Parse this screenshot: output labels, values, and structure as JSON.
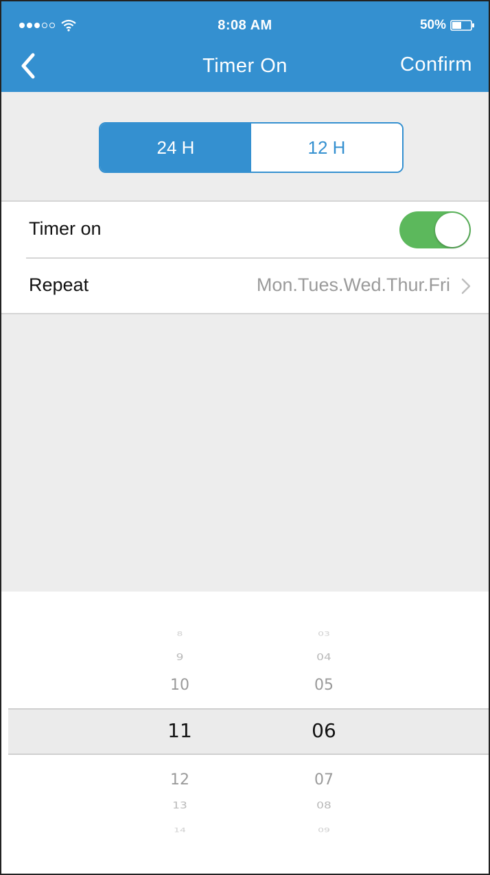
{
  "status_bar": {
    "time": "8:08 AM",
    "battery_percent": "50%",
    "signal_strength": 3,
    "signal_max": 5,
    "battery_level": 0.5
  },
  "nav": {
    "title": "Timer On",
    "confirm_label": "Confirm",
    "back_icon": "chevron-left-icon"
  },
  "format_toggle": {
    "options": [
      "24 H",
      "12 H"
    ],
    "selected": "24 H"
  },
  "settings": {
    "timer_on": {
      "label": "Timer on",
      "enabled": true
    },
    "repeat": {
      "label": "Repeat",
      "value": "Mon.Tues.Wed.Thur.Fri"
    }
  },
  "picker": {
    "hours": [
      "8",
      "9",
      "10",
      "11",
      "12",
      "13",
      "14"
    ],
    "minutes": [
      "03",
      "04",
      "05",
      "06",
      "07",
      "08",
      "09"
    ],
    "selected_hour": "11",
    "selected_minute": "06"
  },
  "colors": {
    "accent": "#3490d0",
    "toggle_on": "#5cb85c",
    "background": "#ededed"
  }
}
